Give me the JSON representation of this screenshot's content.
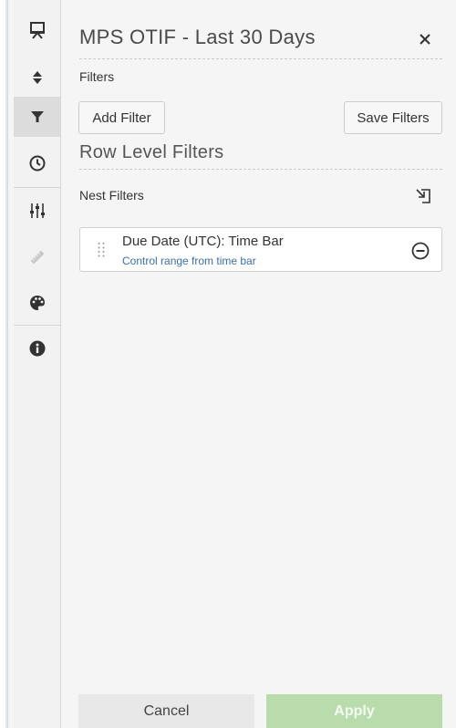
{
  "panel": {
    "title": "MPS OTIF - Last 30 Days",
    "filters_label": "Filters",
    "add_filter_label": "Add Filter",
    "save_filters_label": "Save Filters",
    "row_level_title": "Row Level Filters",
    "nest_filters_label": "Nest Filters",
    "filter_items": [
      {
        "name": "Due Date (UTC): Time Bar",
        "description": "Control range from time bar"
      }
    ],
    "cancel_label": "Cancel",
    "apply_label": "Apply"
  },
  "rail": {
    "icons": [
      "presentation-icon",
      "sort-icon",
      "filter-icon",
      "clock-icon",
      "sliders-icon",
      "ruler-icon",
      "palette-icon",
      "info-icon"
    ],
    "active": "filter-icon"
  },
  "colors": {
    "apply_bg": "#b9dcac",
    "link": "#3a6fa8",
    "active_rail": "#dcdcdc"
  }
}
